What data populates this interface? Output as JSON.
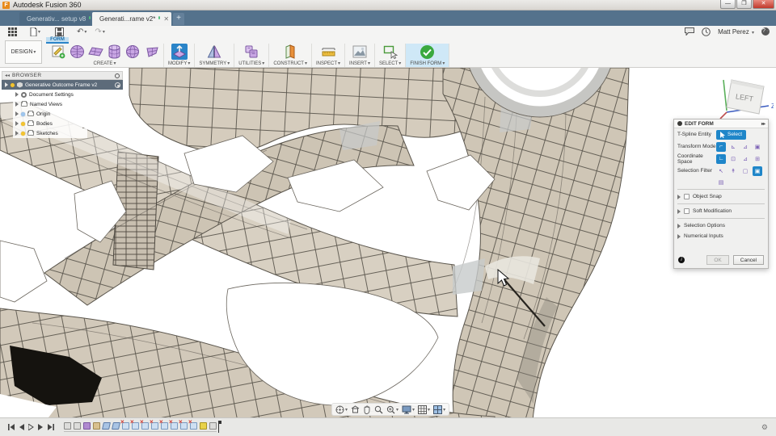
{
  "window": {
    "title": "Autodesk Fusion 360"
  },
  "document_tabs": [
    {
      "label": "Generativ... setup v8",
      "state": "saved"
    },
    {
      "label": "Generati...rame v2*",
      "state": "modified"
    }
  ],
  "qat_icons": [
    "app-grid",
    "file-new",
    "save",
    "undo",
    "redo"
  ],
  "top_right": {
    "icons": [
      "comment",
      "job-status-clock",
      "help"
    ],
    "user": "Matt Perez"
  },
  "ribbon": {
    "workspace": "DESIGN",
    "context_tab": "FORM",
    "groups": [
      {
        "label": "CREATE",
        "icons": [
          "create-form",
          "box",
          "plane",
          "cylinder",
          "sphere",
          "quadball"
        ]
      },
      {
        "label": "MODIFY",
        "icons": [
          "edit-form-selected"
        ]
      },
      {
        "label": "SYMMETRY",
        "icons": [
          "mirror"
        ]
      },
      {
        "label": "UTILITIES",
        "icons": [
          "convert"
        ]
      },
      {
        "label": "CONSTRUCT",
        "icons": [
          "construct-plane"
        ]
      },
      {
        "label": "INSPECT",
        "icons": [
          "measure"
        ]
      },
      {
        "label": "INSERT",
        "icons": [
          "insert-image"
        ]
      },
      {
        "label": "SELECT",
        "icons": [
          "select-window"
        ]
      },
      {
        "label": "FINISH FORM",
        "icons": [
          "finish-check"
        ]
      }
    ]
  },
  "browser": {
    "title": "BROWSER",
    "root": {
      "label": "Generative Outcome Frame v2"
    },
    "items": [
      {
        "label": "Document Settings",
        "icon": "gear"
      },
      {
        "label": "Named Views",
        "icon": "folder"
      },
      {
        "label": "Origin",
        "icon": "folder",
        "bulb": "blue"
      },
      {
        "label": "Bodies",
        "icon": "folder",
        "bulb": "yellow"
      },
      {
        "label": "Sketches",
        "icon": "folder",
        "bulb": "yellow"
      }
    ]
  },
  "viewcube": {
    "face": "LEFT",
    "axis_label": "Z"
  },
  "edit_form": {
    "title": "EDIT FORM",
    "rows": [
      {
        "label": "T-Spline Entity",
        "control": "Select"
      },
      {
        "label": "Transform Mode",
        "selected_index": 0
      },
      {
        "label": "Coordinate Space",
        "selected_index": 0
      },
      {
        "label": "Selection Filter",
        "selected_index": 3
      }
    ],
    "sections": [
      {
        "label": "Object Snap",
        "checkbox": true,
        "checked": false
      },
      {
        "label": "Soft Modification",
        "checkbox": true,
        "checked": false
      },
      {
        "label": "Selection Options",
        "checkbox": false
      },
      {
        "label": "Numerical Inputs",
        "checkbox": false
      }
    ],
    "buttons": {
      "ok": "OK",
      "cancel": "Cancel"
    }
  },
  "navbar_icons": [
    "orbit",
    "look-at",
    "pan",
    "zoom",
    "fit",
    "display-settings",
    "grid-and-snaps",
    "viewports"
  ],
  "timeline": {
    "playback": [
      "go-to-start",
      "step-back",
      "play",
      "step-forward",
      "go-to-end"
    ],
    "features": [
      "form",
      "form",
      "form-current",
      "base",
      "plane",
      "plane",
      "error",
      "error",
      "error",
      "error",
      "error",
      "error",
      "error",
      "error",
      "flag",
      "form"
    ]
  },
  "colors": {
    "tab_bar": "#54728c",
    "accent_blue": "#1f86c9",
    "selected_icon_blue": "#2a84c8",
    "finish_green": "#3aa93f",
    "mesh_tan": "#d2c9ba",
    "error_red": "#d43c32",
    "browser_root_bg": "#5d6b7a"
  }
}
